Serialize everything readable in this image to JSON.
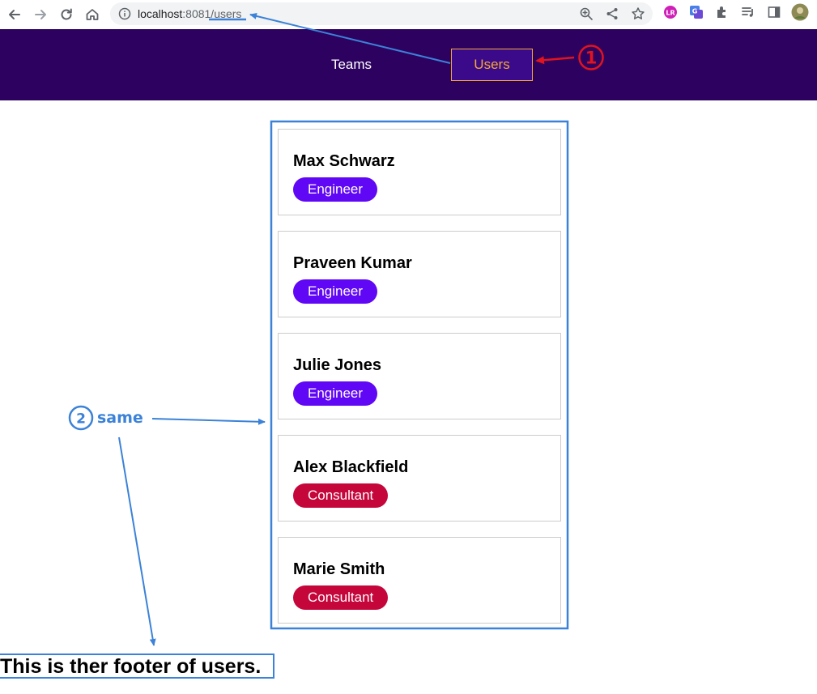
{
  "browser": {
    "url_host": "localhost",
    "url_port_path": ":8081/users",
    "back_icon": "arrow-left-icon",
    "forward_icon": "arrow-right-icon",
    "reload_icon": "reload-icon",
    "home_icon": "home-icon"
  },
  "header": {
    "nav": [
      {
        "label": "Teams",
        "active": false
      },
      {
        "label": "Users",
        "active": true
      }
    ],
    "background": "#2d0160",
    "active_color": "#f5a836"
  },
  "users": [
    {
      "name": "Max Schwarz",
      "role": "Engineer",
      "role_color": "#6007f5"
    },
    {
      "name": "Praveen Kumar",
      "role": "Engineer",
      "role_color": "#6007f5"
    },
    {
      "name": "Julie Jones",
      "role": "Engineer",
      "role_color": "#6007f5"
    },
    {
      "name": "Alex Blackfield",
      "role": "Consultant",
      "role_color": "#c5063b"
    },
    {
      "name": "Marie Smith",
      "role": "Consultant",
      "role_color": "#c5063b"
    }
  ],
  "footer": {
    "text": "This is ther footer of users."
  },
  "annotations": {
    "marker_1": "1",
    "marker_2": "2",
    "label_same": "same",
    "red": "#e0141e",
    "blue": "#3b82d8"
  }
}
